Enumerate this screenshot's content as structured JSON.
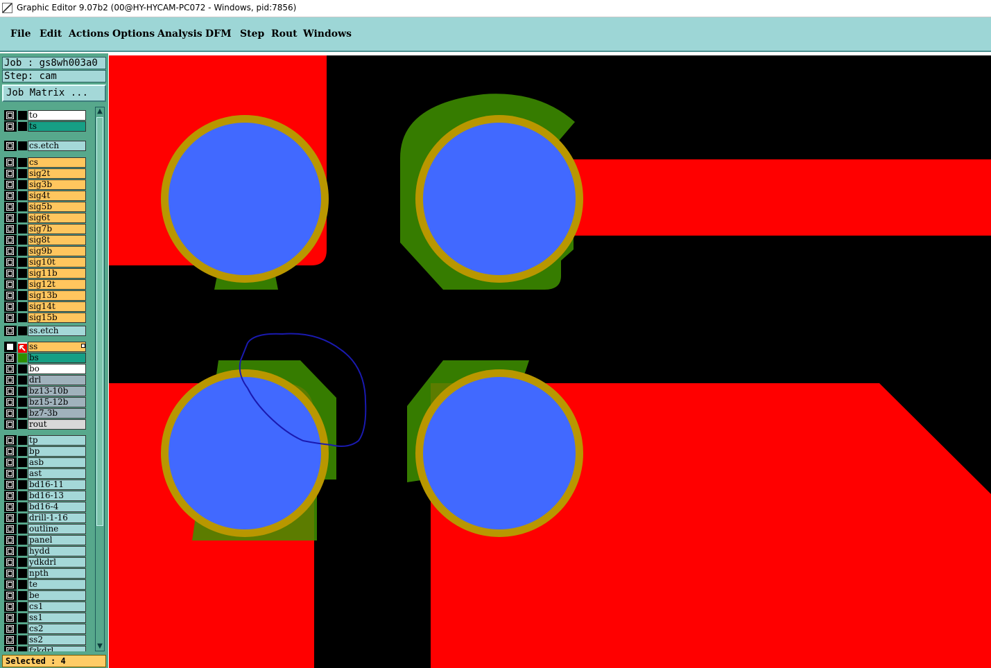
{
  "window": {
    "title": "Graphic Editor 9.07b2 (00@HY-HYCAM-PC072 - Windows, pid:7856)"
  },
  "menu": [
    "File",
    "Edit",
    "Actions",
    "Options",
    "Analysis",
    "DFM",
    "Step",
    "Rout",
    "Windows"
  ],
  "job": {
    "label": "Job : gs8wh003a0",
    "step": "Step: cam"
  },
  "job_matrix_button": "Job Matrix ...",
  "layers": [
    {
      "name": "to",
      "color": "#ffffff",
      "mark": ""
    },
    {
      "name": "ts",
      "color": "#169f85",
      "mark": ""
    },
    {
      "name": "cs.etch",
      "color": "#a4d8d8",
      "mark": ""
    },
    {
      "name": "cs",
      "color": "#ffc65e",
      "mark": ""
    },
    {
      "name": "sig2t",
      "color": "#ffc65e",
      "mark": ""
    },
    {
      "name": "sig3b",
      "color": "#ffc65e",
      "mark": ""
    },
    {
      "name": "sig4t",
      "color": "#ffc65e",
      "mark": ""
    },
    {
      "name": "sig5b",
      "color": "#ffc65e",
      "mark": ""
    },
    {
      "name": "sig6t",
      "color": "#ffc65e",
      "mark": ""
    },
    {
      "name": "sig7b",
      "color": "#ffc65e",
      "mark": ""
    },
    {
      "name": "sig8t",
      "color": "#ffc65e",
      "mark": ""
    },
    {
      "name": "sig9b",
      "color": "#ffc65e",
      "mark": ""
    },
    {
      "name": "sig10t",
      "color": "#ffc65e",
      "mark": ""
    },
    {
      "name": "sig11b",
      "color": "#ffc65e",
      "mark": ""
    },
    {
      "name": "sig12t",
      "color": "#ffc65e",
      "mark": ""
    },
    {
      "name": "sig13b",
      "color": "#ffc65e",
      "mark": ""
    },
    {
      "name": "sig14t",
      "color": "#ffc65e",
      "mark": ""
    },
    {
      "name": "sig15b",
      "color": "#ffc65e",
      "mark": ""
    },
    {
      "name": "ss.etch",
      "color": "#a4d8d8",
      "mark": ""
    },
    {
      "name": "ss",
      "color": "#ffc65e",
      "mark": "work",
      "checked": true
    },
    {
      "name": "bs",
      "color": "#169f85",
      "mark": "green"
    },
    {
      "name": "bo",
      "color": "#ffffff",
      "mark": ""
    },
    {
      "name": "drl",
      "color": "#a0b2bc",
      "mark": ""
    },
    {
      "name": "bz13-10b",
      "color": "#a0b2bc",
      "mark": ""
    },
    {
      "name": "bz15-12b",
      "color": "#a0b2bc",
      "mark": ""
    },
    {
      "name": "bz7-3b",
      "color": "#a0b2bc",
      "mark": ""
    },
    {
      "name": "rout",
      "color": "#d8d8d8",
      "mark": ""
    },
    {
      "name": "tp",
      "color": "#a4d8d8",
      "mark": ""
    },
    {
      "name": "bp",
      "color": "#a4d8d8",
      "mark": ""
    },
    {
      "name": "asb",
      "color": "#a4d8d8",
      "mark": ""
    },
    {
      "name": "ast",
      "color": "#a4d8d8",
      "mark": ""
    },
    {
      "name": "bd16-11",
      "color": "#a4d8d8",
      "mark": ""
    },
    {
      "name": "bd16-13",
      "color": "#a4d8d8",
      "mark": ""
    },
    {
      "name": "bd16-4",
      "color": "#a4d8d8",
      "mark": ""
    },
    {
      "name": "drill-1-16",
      "color": "#a4d8d8",
      "mark": ""
    },
    {
      "name": "outline",
      "color": "#a4d8d8",
      "mark": ""
    },
    {
      "name": "panel",
      "color": "#a4d8d8",
      "mark": ""
    },
    {
      "name": "hydd",
      "color": "#a4d8d8",
      "mark": ""
    },
    {
      "name": "ydkdrl",
      "color": "#a4d8d8",
      "mark": ""
    },
    {
      "name": "npth",
      "color": "#a4d8d8",
      "mark": ""
    },
    {
      "name": "te",
      "color": "#a4d8d8",
      "mark": ""
    },
    {
      "name": "be",
      "color": "#a4d8d8",
      "mark": ""
    },
    {
      "name": "cs1",
      "color": "#a4d8d8",
      "mark": ""
    },
    {
      "name": "ss1",
      "color": "#a4d8d8",
      "mark": ""
    },
    {
      "name": "cs2",
      "color": "#a4d8d8",
      "mark": ""
    },
    {
      "name": "ss2",
      "color": "#a4d8d8",
      "mark": ""
    },
    {
      "name": "fzkdrl",
      "color": "#a4d8d8",
      "mark": ""
    }
  ],
  "status": "Selected : 4",
  "canvas_colors": {
    "background": "#000000",
    "copper": "#ff0000",
    "soldermask": "#3f9200",
    "pad_ring": "#b99700",
    "drill": "#4169ff",
    "annotation": "#1a1ab0"
  }
}
